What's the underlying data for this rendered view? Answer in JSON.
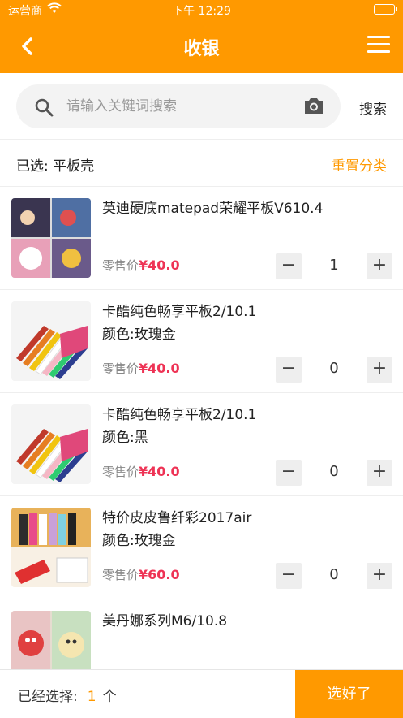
{
  "status_bar": {
    "carrier": "运营商",
    "time": "下午 12:29"
  },
  "navbar": {
    "title": "收银"
  },
  "search": {
    "placeholder": "请输入关键词搜索",
    "button_label": "搜索"
  },
  "filter": {
    "selected_label": "已选: 平板壳",
    "reset_label": "重置分类"
  },
  "products": [
    {
      "name": "英迪硬底matepad荣耀平板V610.4",
      "attr": "",
      "price_label": "零售价",
      "price": "¥40.0",
      "qty": "1",
      "minus": "−",
      "plus": "+"
    },
    {
      "name": "卡酷纯色畅享平板2/10.1",
      "attr": "颜色:玫瑰金",
      "price_label": "零售价",
      "price": "¥40.0",
      "qty": "0",
      "minus": "−",
      "plus": "+"
    },
    {
      "name": "卡酷纯色畅享平板2/10.1",
      "attr": "颜色:黑",
      "price_label": "零售价",
      "price": "¥40.0",
      "qty": "0",
      "minus": "−",
      "plus": "+"
    },
    {
      "name": "特价皮皮鲁纤彩2017air",
      "attr": "颜色:玫瑰金",
      "price_label": "零售价",
      "price": "¥60.0",
      "qty": "0",
      "minus": "−",
      "plus": "+"
    },
    {
      "name": "美丹娜系列M6/10.8",
      "attr": "",
      "price_label": "",
      "price": "",
      "qty": "",
      "minus": "",
      "plus": ""
    }
  ],
  "bottom": {
    "prefix": "已经选择:",
    "count": "1",
    "suffix": "个",
    "done_label": "选好了"
  },
  "colors": {
    "accent": "#ff9900",
    "price": "#ee3355"
  }
}
